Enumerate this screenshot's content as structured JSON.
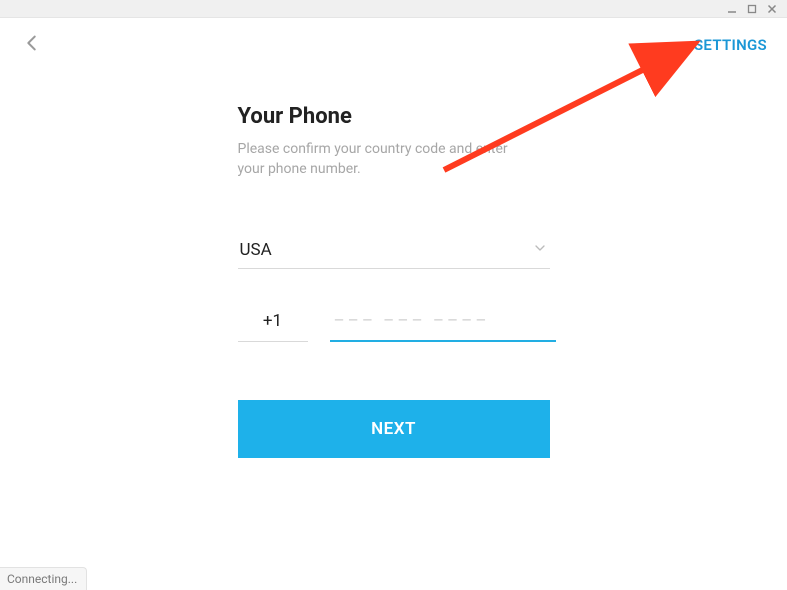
{
  "colors": {
    "accent": "#1eb1ea",
    "link": "#1b97d6",
    "annotation": "#ff3b1f"
  },
  "header": {
    "settings_label": "SETTINGS"
  },
  "form": {
    "title": "Your Phone",
    "subtitle": "Please confirm your country code and enter your phone number.",
    "country": "USA",
    "code_value": "+1",
    "phone_value": "",
    "phone_placeholder": "––– ––– ––––",
    "next_label": "NEXT"
  },
  "status": {
    "text": "Connecting..."
  }
}
